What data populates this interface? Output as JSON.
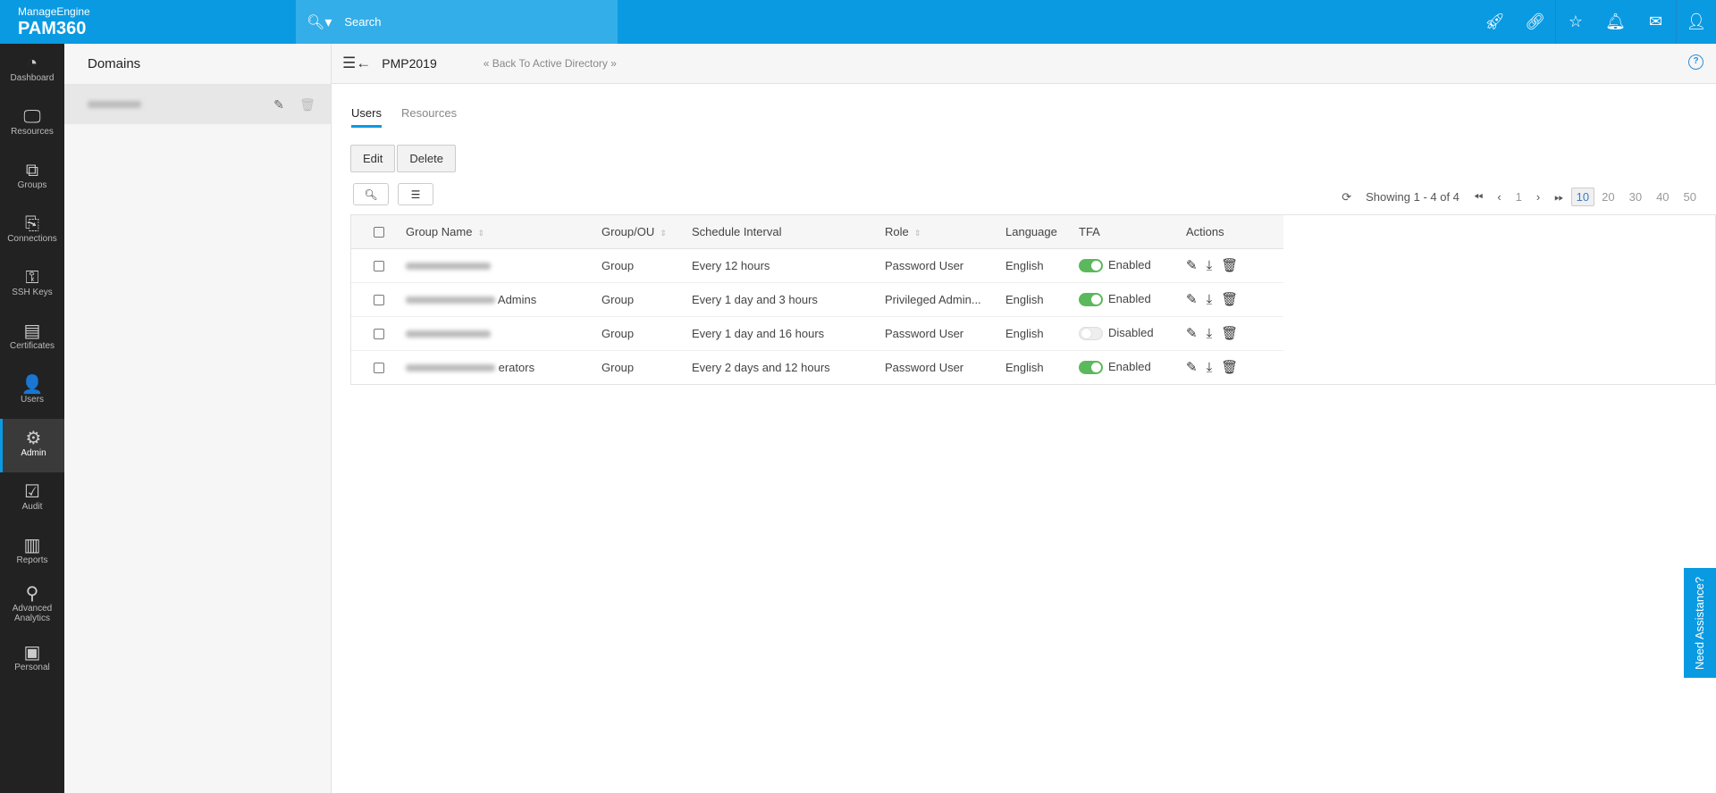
{
  "header": {
    "brand_top": "ManageEngine",
    "brand": "PAM360",
    "search_placeholder": "Search"
  },
  "top_icons": [
    "rocket-icon",
    "link-settings-icon",
    "user-star-icon",
    "bell-icon",
    "mail-icon",
    "user-icon"
  ],
  "sidebar": {
    "items": [
      {
        "label": "Dashboard",
        "icon": "◔"
      },
      {
        "label": "Resources",
        "icon": "🖵"
      },
      {
        "label": "Groups",
        "icon": "⧉"
      },
      {
        "label": "Connections",
        "icon": "⎘"
      },
      {
        "label": "SSH Keys",
        "icon": "⚿"
      },
      {
        "label": "Certificates",
        "icon": "▤"
      },
      {
        "label": "Users",
        "icon": "👤"
      },
      {
        "label": "Admin",
        "icon": "⚙",
        "active": true
      },
      {
        "label": "Audit",
        "icon": "☑"
      },
      {
        "label": "Reports",
        "icon": "▥"
      },
      {
        "label": "Advanced Analytics",
        "icon": "⚲"
      },
      {
        "label": "Personal",
        "icon": "▣"
      }
    ]
  },
  "domains": {
    "title": "Domains"
  },
  "main": {
    "title": "PMP2019",
    "back_link": "« Back To Active Directory »",
    "help": "?",
    "tabs": [
      {
        "label": "Users",
        "active": true
      },
      {
        "label": "Resources"
      }
    ],
    "buttons": {
      "edit": "Edit",
      "delete": "Delete"
    },
    "pager": {
      "showing": "Showing 1 - 4 of 4",
      "page": "1",
      "sizes": [
        "10",
        "20",
        "30",
        "40",
        "50"
      ],
      "selected_size": "10"
    },
    "columns": [
      "Group Name",
      "Group/OU",
      "Schedule Interval",
      "Role",
      "Language",
      "TFA",
      "Actions"
    ],
    "rows": [
      {
        "name_visible": "",
        "type": "Group",
        "interval": "Every 12 hours",
        "role": "Password User",
        "language": "English",
        "tfa": "Enabled",
        "tfa_on": true
      },
      {
        "name_visible": "Admins",
        "type": "Group",
        "interval": "Every 1 day and 3 hours",
        "role": "Privileged Admin...",
        "language": "English",
        "tfa": "Enabled",
        "tfa_on": true
      },
      {
        "name_visible": "",
        "type": "Group",
        "interval": "Every 1 day and 16 hours",
        "role": "Password User",
        "language": "English",
        "tfa": "Disabled",
        "tfa_on": false
      },
      {
        "name_visible": "erators",
        "type": "Group",
        "interval": "Every 2 days and 12 hours",
        "role": "Password User",
        "language": "English",
        "tfa": "Enabled",
        "tfa_on": true
      }
    ]
  },
  "assist": "Need Assistance?"
}
